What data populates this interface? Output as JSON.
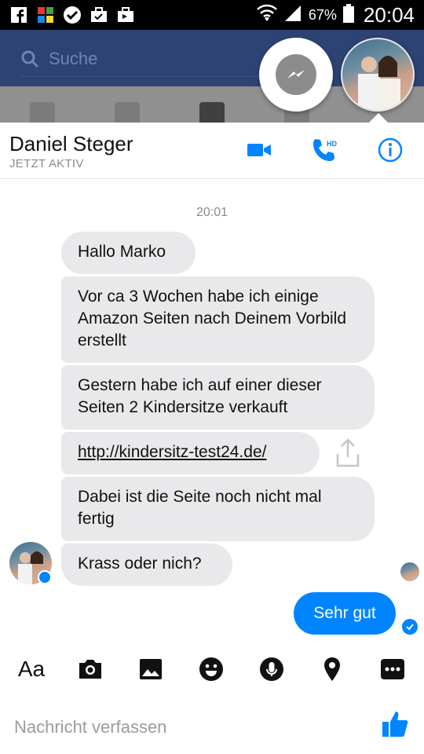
{
  "status_bar": {
    "battery": "67%",
    "time": "20:04",
    "left_icons": [
      "facebook-icon",
      "app-icon",
      "check-icon",
      "briefcase-icon",
      "briefcase-icon"
    ]
  },
  "background_app": {
    "search_placeholder": "Suche"
  },
  "chat": {
    "contact_name": "Daniel Steger",
    "contact_status": "JETZT AKTIV",
    "timestamp": "20:01",
    "messages": [
      {
        "text": "Hallo Marko"
      },
      {
        "text": "Vor ca 3 Wochen habe ich einige Amazon Seiten nach Deinem Vorbild erstellt"
      },
      {
        "text": "Gestern habe ich auf einer dieser Seiten 2 Kindersitze verkauft"
      },
      {
        "text": "http://kindersitz-test24.de/"
      },
      {
        "text": "Dabei ist die Seite noch nicht mal fertig"
      },
      {
        "text": "Krass oder nich?"
      }
    ],
    "outgoing": {
      "text": "Sehr gut"
    }
  },
  "toolbar": {
    "aa_label": "Aa"
  },
  "composer": {
    "placeholder": "Nachricht verfassen"
  },
  "colors": {
    "accent": "#0084ff",
    "bubble_gray": "#e9e9eb",
    "fb_blue": "#2d4373"
  }
}
